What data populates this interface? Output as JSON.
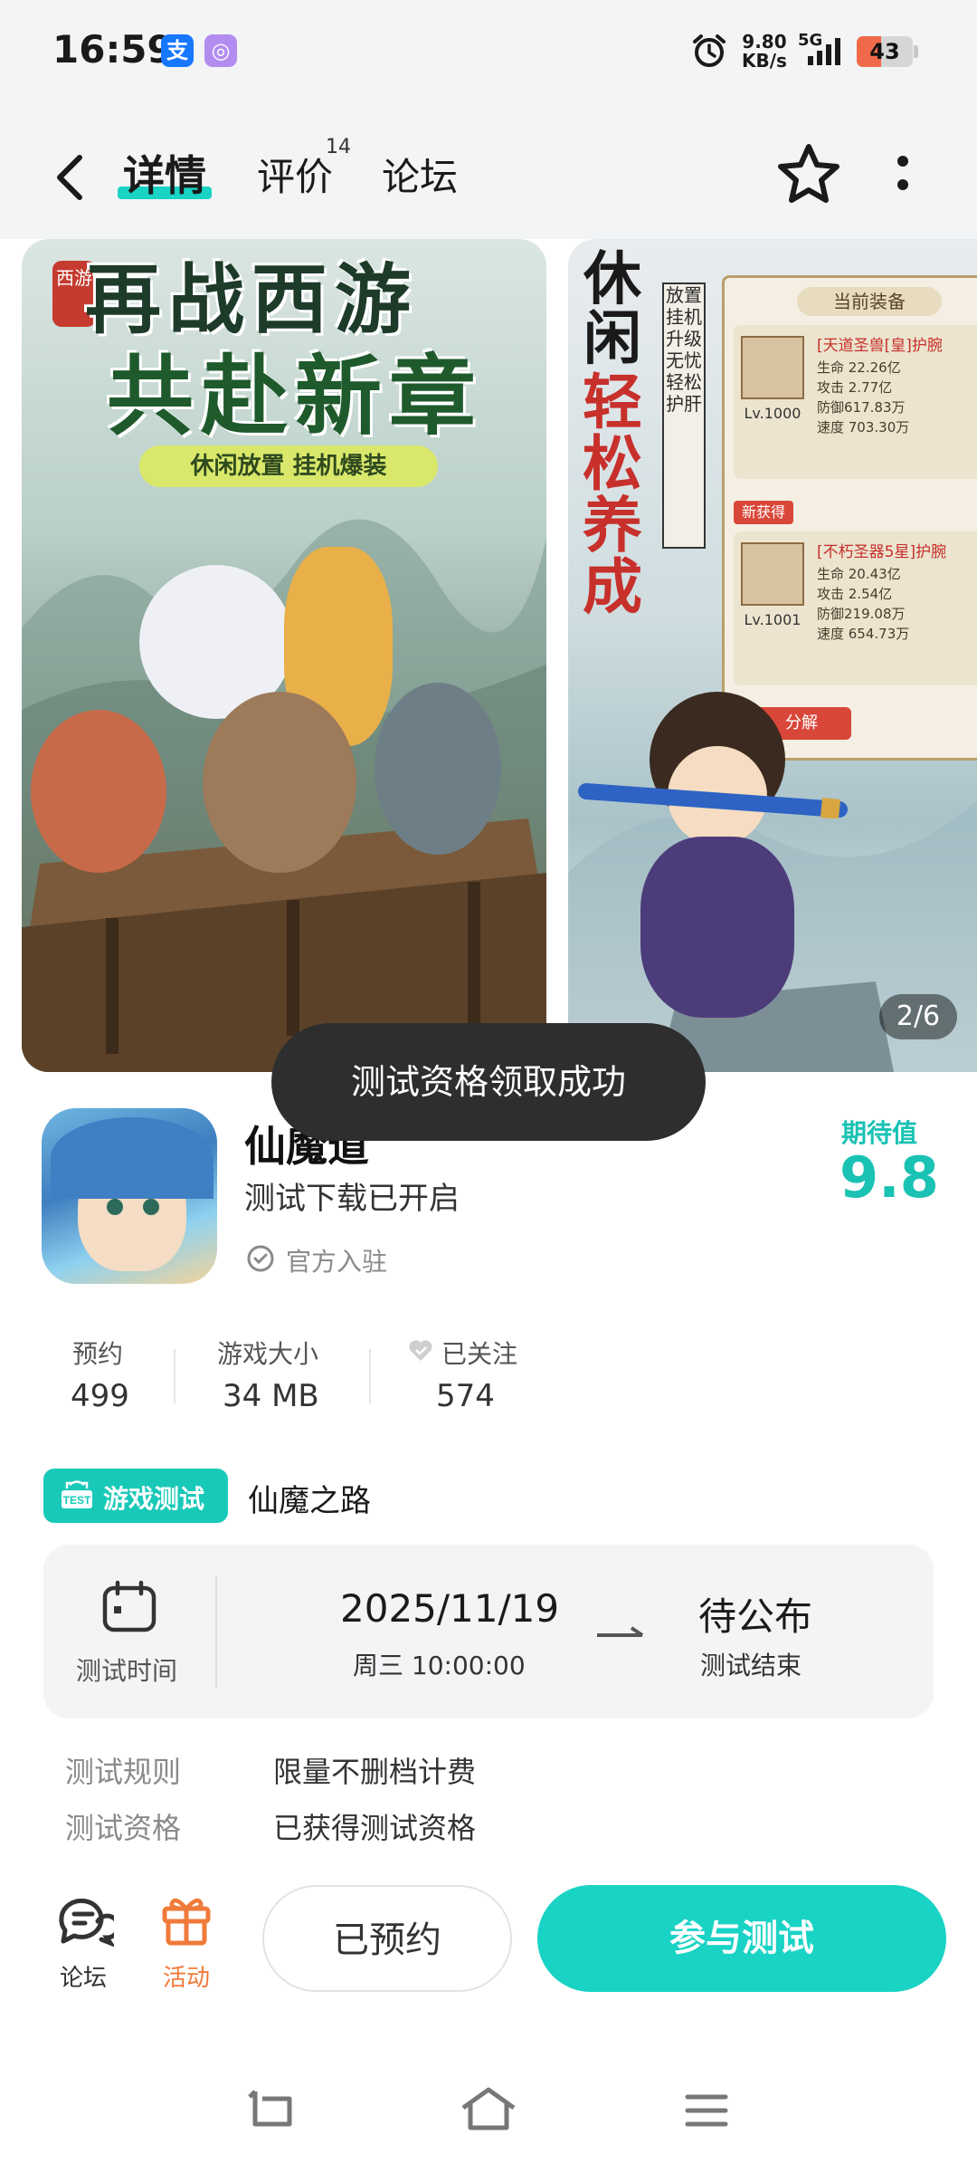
{
  "status_bar": {
    "time": "16:59",
    "app_badges": [
      {
        "icon": "alipay-icon",
        "glyph": "支",
        "color": "#1677ff"
      },
      {
        "icon": "pay-icon",
        "glyph": "◎",
        "color": "#b38cf0"
      }
    ],
    "net_speed": "9.80",
    "net_unit": "KB/s",
    "network": "5G",
    "battery": 43
  },
  "header": {
    "tabs": [
      {
        "label": "详情",
        "active": true
      },
      {
        "label": "评价",
        "count": "14"
      },
      {
        "label": "论坛"
      }
    ]
  },
  "banners": {
    "banner1": {
      "line1": "再战西游",
      "line2": "共赴新章",
      "subtitle": "休闲放置 挂机爆装",
      "seal": "西游"
    },
    "banner2": {
      "vertical_title": "休闲",
      "vertical_red": "轻松养成",
      "vertical_small": "放置挂机 升级无忧 轻松护肝",
      "panel_head": "当前装备",
      "card1": {
        "title": "[天道圣兽[皇]护腕",
        "level": "Lv.1000",
        "stats": [
          "生命 22.26亿",
          "攻击 2.77亿",
          "防御617.83万",
          "速度 703.30万"
        ]
      },
      "new_tag": "新获得",
      "card2": {
        "title": "[不朽圣器5星]护腕",
        "level": "Lv.1001",
        "stats": [
          "生命 20.43亿",
          "攻击 2.54亿",
          "防御219.08万",
          "速度 654.73万"
        ]
      },
      "button": "分解"
    },
    "page_indicator": "2/6"
  },
  "toast": "测试资格领取成功",
  "game": {
    "name": "仙魔道",
    "status": "测试下载已开启",
    "official": "官方入驻",
    "expect_label": "期待值",
    "expect_value": "9.8"
  },
  "stats": [
    {
      "label": "预约",
      "value": "499"
    },
    {
      "label": "游戏大小",
      "value": "34 MB"
    },
    {
      "label": "已关注",
      "value": "574"
    }
  ],
  "test": {
    "tag": "游戏测试",
    "tag_icon_text": "TEST",
    "name": "仙魔之路",
    "time_label": "测试时间",
    "start_date": "2025/11/19",
    "start_time": "周三 10:00:00",
    "end_status": "待公布",
    "end_label": "测试结束",
    "rules": [
      {
        "label": "测试规则",
        "value": "限量不删档计费"
      },
      {
        "label": "测试资格",
        "value": "已获得测试资格"
      }
    ]
  },
  "bottom_bar": {
    "forum_label": "论坛",
    "activity_label": "活动",
    "reserved_label": "已预约",
    "join_label": "参与测试",
    "accent_color": "#19d3c5",
    "activity_color": "#f07a3a"
  }
}
